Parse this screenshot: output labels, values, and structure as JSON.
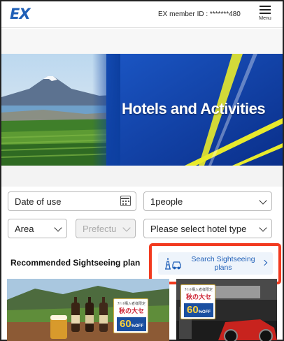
{
  "header": {
    "logo_text": "EX",
    "member_label": "EX member ID : *******480",
    "menu_label": "Menu"
  },
  "banner": {
    "title": "Hotels and Activities"
  },
  "search_form": {
    "date_placeholder": "Date of use",
    "people_value": "1people",
    "area_value": "Area",
    "prefecture_value": "Prefectu",
    "hotel_type_value": "Please select hotel type"
  },
  "sightseeing": {
    "section_title": "Recommended Sightseeing plan",
    "search_button_label": "Search Sightseeing plans"
  },
  "cards": [
    {
      "badge_top": "ﾁｹｯﾄ購入者様限定",
      "badge_sale": "秋の大セール",
      "badge_value": "60",
      "badge_suffix": "%OFF"
    },
    {
      "badge_top": "ﾁｹｯﾄ購入者様限定",
      "badge_sale": "秋の大セール",
      "badge_value": "60",
      "badge_suffix": "%OFF"
    }
  ],
  "colors": {
    "brand_blue": "#1f5fb7",
    "highlight_red": "#f23a1f",
    "banner_blue": "#0c3fa0",
    "banner_yellow": "#e8ea2c"
  }
}
